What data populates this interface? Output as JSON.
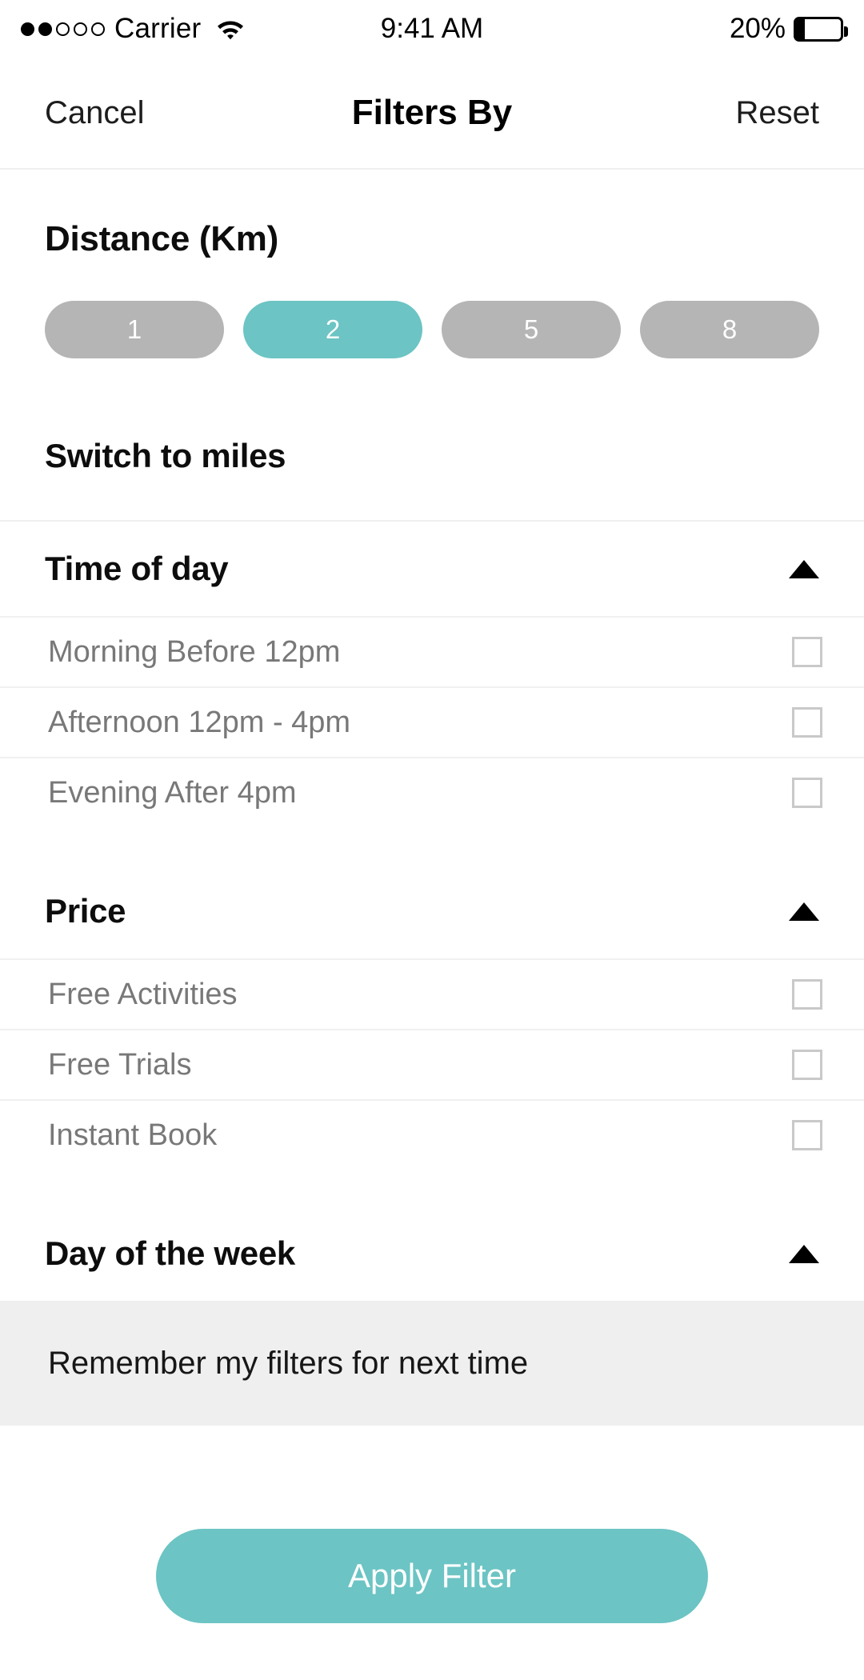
{
  "status_bar": {
    "signal_dots_total": 5,
    "signal_dots_filled": 2,
    "carrier": "Carrier",
    "wifi_icon": "wifi-icon",
    "time": "9:41 AM",
    "battery_percent": "20%",
    "battery_level": 20
  },
  "header": {
    "cancel_label": "Cancel",
    "title": "Filters By",
    "reset_label": "Reset"
  },
  "distance": {
    "title": "Distance (Km)",
    "options": [
      {
        "label": "1",
        "selected": false
      },
      {
        "label": "2",
        "selected": true
      },
      {
        "label": "5",
        "selected": false
      },
      {
        "label": "8",
        "selected": false
      }
    ],
    "switch_units_label": "Switch to miles"
  },
  "sections": [
    {
      "title": "Time of day",
      "expanded": true,
      "caret_icon": "caret-up-icon",
      "options": [
        {
          "label": "Morning Before 12pm",
          "checked": false
        },
        {
          "label": "Afternoon 12pm - 4pm",
          "checked": false
        },
        {
          "label": "Evening After 4pm",
          "checked": false
        }
      ]
    },
    {
      "title": "Price",
      "expanded": true,
      "caret_icon": "caret-up-icon",
      "options": [
        {
          "label": "Free Activities",
          "checked": false
        },
        {
          "label": "Free Trials",
          "checked": false
        },
        {
          "label": "Instant Book",
          "checked": false
        }
      ]
    },
    {
      "title": "Day of the week",
      "expanded": true,
      "caret_icon": "caret-up-icon",
      "options": []
    }
  ],
  "remember": {
    "label": "Remember my filters for next time"
  },
  "footer": {
    "apply_label": "Apply Filter"
  },
  "colors": {
    "accent_teal": "#6cc4c4",
    "pill_gray": "#b5b5b5",
    "banner_gray": "#efefef",
    "option_text": "#787878",
    "checkbox_border": "#c9c9c9",
    "divider": "#efefef"
  }
}
